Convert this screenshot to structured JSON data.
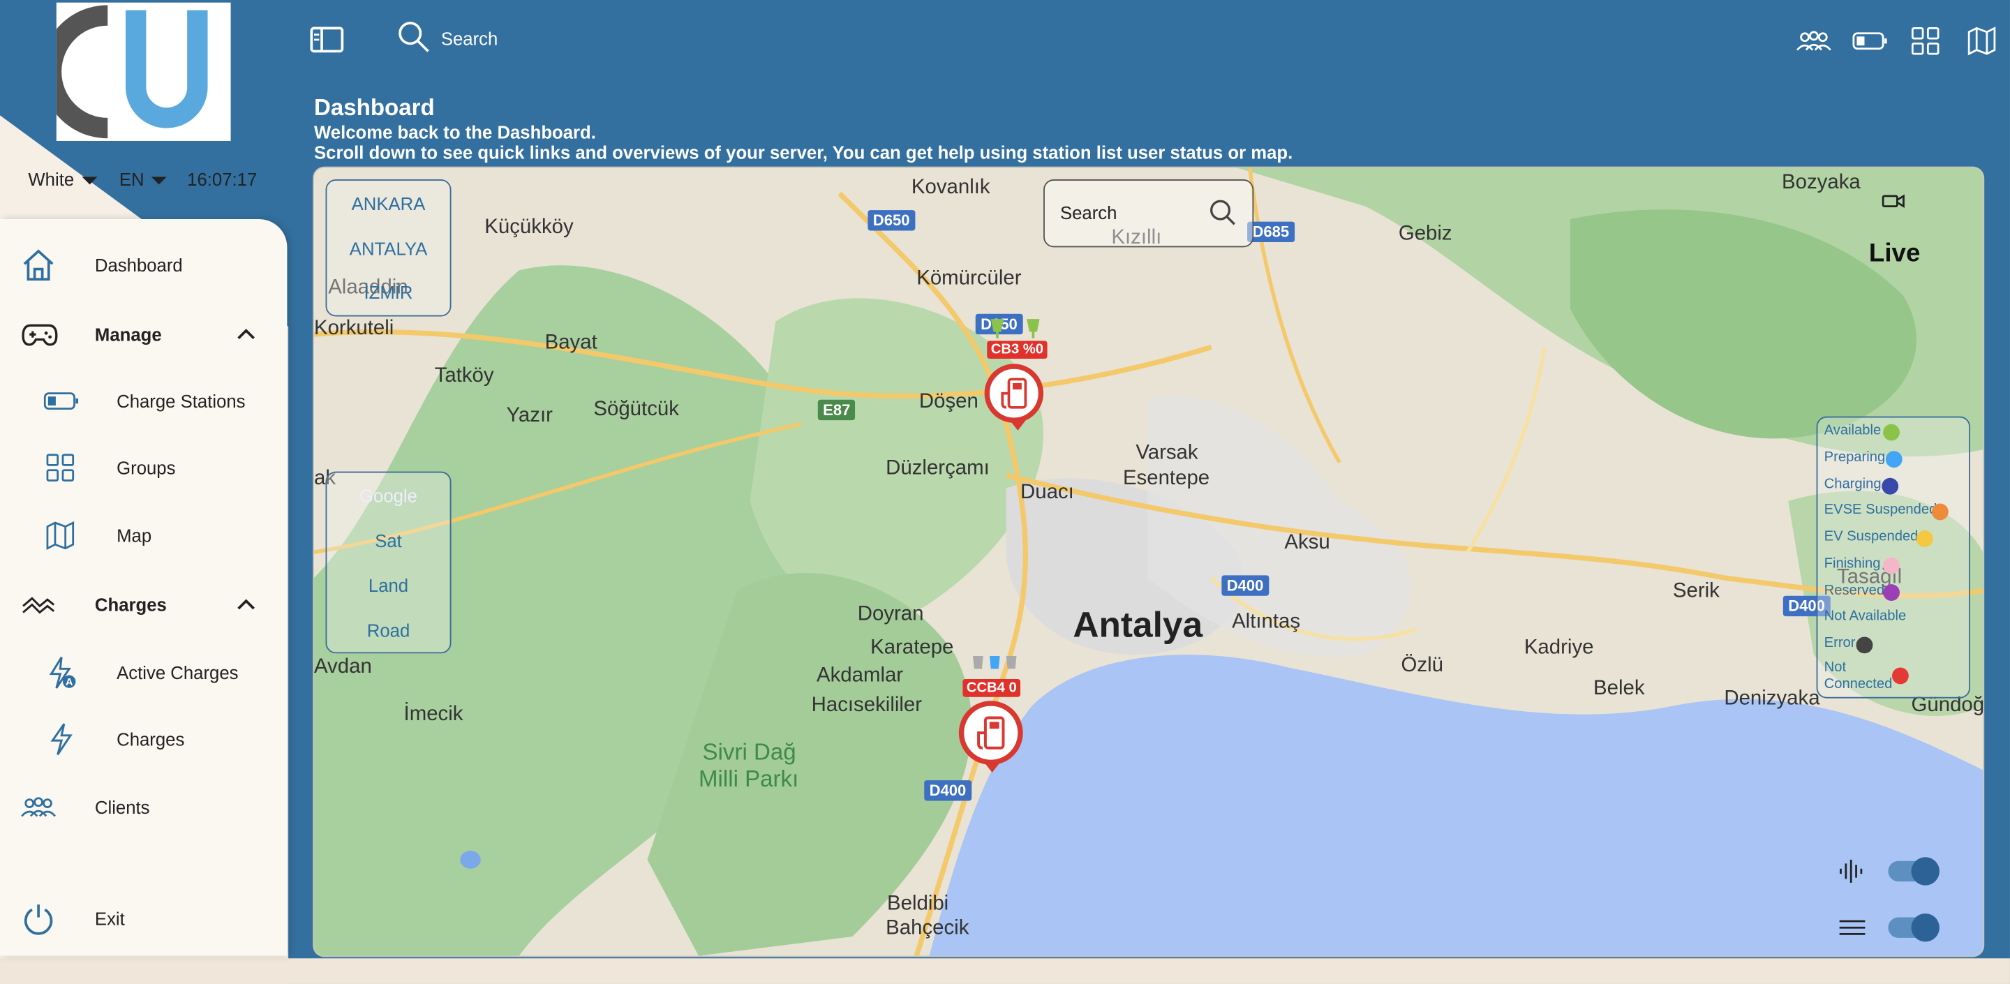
{
  "header": {
    "search_label": "Search",
    "title": "Dashboard",
    "welcome": "Welcome back to the Dashboard.",
    "subtitle": "Scroll down to see quick links and overviews of your server, You can get help using station list user status or map.",
    "right_icons": [
      "clients-icon",
      "battery-icon",
      "grid-icon",
      "map-icon"
    ]
  },
  "controls": {
    "theme": "White",
    "language": "EN",
    "clock": "16:07:17"
  },
  "sidebar": {
    "items": [
      {
        "label": "Dashboard",
        "icon": "home-icon"
      },
      {
        "label": "Manage",
        "icon": "gamepad-icon"
      },
      {
        "label": "Charge Stations",
        "icon": "battery-icon"
      },
      {
        "label": "Groups",
        "icon": "grid-icon"
      },
      {
        "label": "Map",
        "icon": "map-icon"
      },
      {
        "label": "Charges",
        "icon": "wave-icon"
      },
      {
        "label": "Active Charges",
        "icon": "bolt-a-icon"
      },
      {
        "label": "Charges",
        "icon": "bolt-icon"
      },
      {
        "label": "Clients",
        "icon": "clients-icon"
      },
      {
        "label": "Exit",
        "icon": "power-icon"
      }
    ]
  },
  "map": {
    "search_placeholder": "Search",
    "live_label": "Live",
    "cities": [
      "ANKARA",
      "ANTALYA",
      "İZMİR"
    ],
    "layers": [
      "Google",
      "Sat",
      "Land",
      "Road"
    ],
    "places": [
      "Kovanlık",
      "Küçükköy",
      "Kızıllı",
      "Gebiz",
      "Bozyaka",
      "Alaaddin",
      "Kömürcüler",
      "Korkuteli",
      "Bayat",
      "Tatköy",
      "Yazır",
      "Söğütcük",
      "Döşen",
      "Düzlerçamı",
      "Duacı",
      "Varsak",
      "Esentepe",
      "Aksu",
      "Antalya",
      "Altıntaş",
      "Doyran",
      "Karatepe",
      "Akdamlar",
      "Hacısekililer",
      "Sivri Dağ",
      "Milli Parkı",
      "Serik",
      "Tasağıl",
      "Kadriye",
      "Özlü",
      "Belek",
      "Denizyaka",
      "Gündoğ",
      "İmecik",
      "Avdan",
      "ak",
      "Beldibi",
      "Bahçecik"
    ],
    "highways": [
      "D650",
      "D685",
      "E87",
      "D400",
      "D400",
      "D400",
      "D650"
    ],
    "stations": [
      {
        "label": "CB3 %0"
      },
      {
        "label": "CCB4 0"
      }
    ],
    "legend": [
      {
        "label": "Available",
        "color": "#8bc34a"
      },
      {
        "label": "Preparing",
        "color": "#42a5f5"
      },
      {
        "label": "Charging",
        "color": "#3949ab"
      },
      {
        "label": "EVSE Suspended",
        "color": "#ef8a3a"
      },
      {
        "label": "EV Suspended",
        "color": "#f5c842"
      },
      {
        "label": "Finishing",
        "color": "#f4b6c9"
      },
      {
        "label": "Reserved",
        "color": "#9c3fb6"
      },
      {
        "label": "Not Available",
        "color": ""
      },
      {
        "label": "Error",
        "color": "#444444"
      },
      {
        "label": "Not Connected",
        "color": "#e53935"
      }
    ],
    "toggles": [
      {
        "icon": "sound-icon",
        "on": true
      },
      {
        "icon": "menu-icon",
        "on": true
      }
    ]
  },
  "colors": {
    "header_blue": "#33709f",
    "accent": "#2f6fa0",
    "marker_red": "#d93831",
    "water": "#a9c4f5"
  }
}
